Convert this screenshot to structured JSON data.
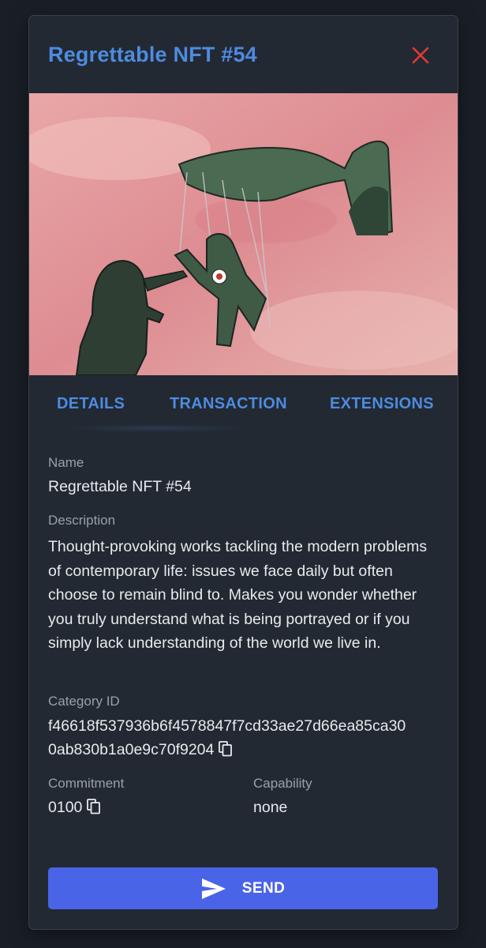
{
  "dialog": {
    "title": "Regrettable NFT #54"
  },
  "tabs": [
    {
      "label": "DETAILS",
      "active": true
    },
    {
      "label": "TRANSACTION"
    },
    {
      "label": "EXTENSIONS"
    }
  ],
  "details": {
    "name_label": "Name",
    "name_value": "Regrettable NFT #54",
    "description_label": "Description",
    "description_value": "Thought-provoking works tackling the modern problems of contemporary life: issues we face daily but often choose to remain blind to. Makes you wonder whether you truly understand what is being portrayed or if you simply lack understanding of the world we live in.",
    "category_label": "Category ID",
    "category_line1": "f46618f537936b6f4578847f7cd33ae27d66ea85ca30",
    "category_line2": "0ab830b1a0e9c70f9204",
    "commitment_label": "Commitment",
    "commitment_value": "0100",
    "capability_label": "Capability",
    "capability_value": "none"
  },
  "actions": {
    "send_label": "SEND"
  },
  "colors": {
    "accent": "#4d8be0",
    "close": "#e53935",
    "send_button": "#4a64e8",
    "panel": "#222932"
  },
  "icons": [
    "close-icon",
    "copy-icon",
    "send-icon"
  ]
}
